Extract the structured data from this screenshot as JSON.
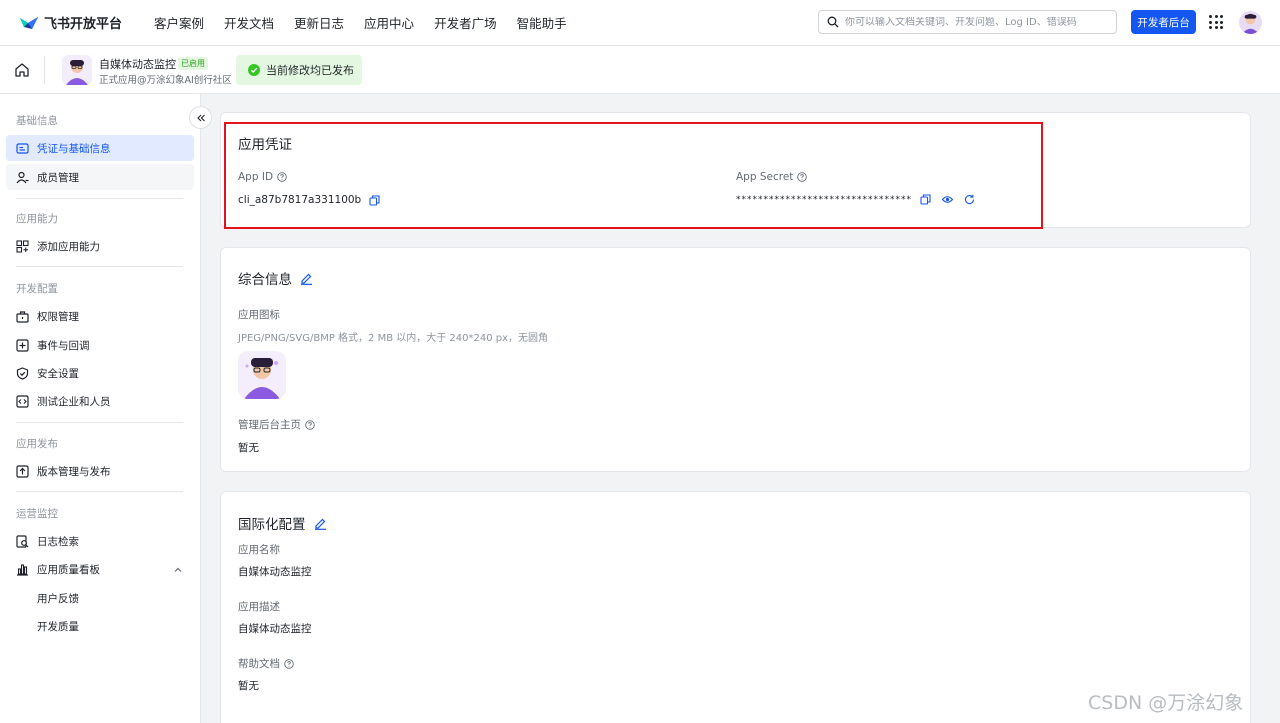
{
  "topbar": {
    "logo_text": "飞书开放平台",
    "nav": [
      "客户案例",
      "开发文档",
      "更新日志",
      "应用中心",
      "开发者广场",
      "智能助手"
    ],
    "search_placeholder": "你可以输入文档关键词、开发问题、Log ID、错误码",
    "dev_console_label": "开发者后台"
  },
  "appbar": {
    "app_name": "自媒体动态监控",
    "app_badge": "已启用",
    "app_sub": "正式应用@万涂幻象AI创行社区",
    "publish_status": "当前修改均已发布"
  },
  "sidebar": {
    "sections": [
      {
        "title": "基础信息",
        "items": [
          "凭证与基础信息",
          "成员管理"
        ]
      },
      {
        "title": "应用能力",
        "items": [
          "添加应用能力"
        ]
      },
      {
        "title": "开发配置",
        "items": [
          "权限管理",
          "事件与回调",
          "安全设置",
          "测试企业和人员"
        ]
      },
      {
        "title": "应用发布",
        "items": [
          "版本管理与发布"
        ]
      },
      {
        "title": "运营监控",
        "items": [
          "日志检索",
          "应用质量看板"
        ]
      }
    ],
    "sub_items": [
      "用户反馈",
      "开发质量"
    ]
  },
  "credentials": {
    "title": "应用凭证",
    "app_id_label": "App ID",
    "app_id": "cli_a87b7817a331100b",
    "app_secret_label": "App Secret",
    "app_secret_masked": "********************************"
  },
  "general": {
    "title": "综合信息",
    "icon_label": "应用图标",
    "icon_hint": "JPEG/PNG/SVG/BMP 格式，2 MB 以内，大于 240*240 px，无圆角",
    "admin_home_label": "管理后台主页",
    "admin_home_value": "暂无"
  },
  "i18n": {
    "title": "国际化配置",
    "name_label": "应用名称",
    "name_value": "自媒体动态监控",
    "desc_label": "应用描述",
    "desc_value": "自媒体动态监控",
    "help_label": "帮助文档",
    "help_value": "暂无"
  },
  "watermark": "CSDN @万涂幻象",
  "colors": {
    "brand": "#1456f0",
    "highlight": "#e3121d",
    "success": "#2ea121"
  }
}
